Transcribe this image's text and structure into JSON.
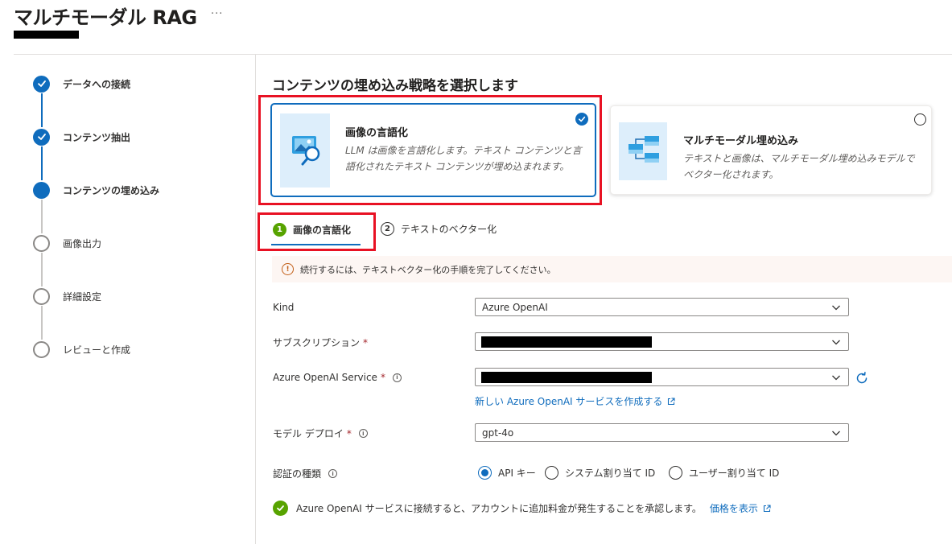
{
  "page": {
    "title": "マルチモーダル RAG",
    "more_label": "···"
  },
  "steps": [
    {
      "label": "データへの接続",
      "state": "done"
    },
    {
      "label": "コンテンツ抽出",
      "state": "done"
    },
    {
      "label": "コンテンツの埋め込み",
      "state": "current"
    },
    {
      "label": "画像出力",
      "state": "todo"
    },
    {
      "label": "詳細設定",
      "state": "todo"
    },
    {
      "label": "レビューと作成",
      "state": "todo"
    }
  ],
  "main": {
    "heading": "コンテンツの埋め込み戦略を選択します",
    "cards": [
      {
        "title": "画像の言語化",
        "description": "LLM は画像を言語化します。テキスト コンテンツと言語化されたテキスト コンテンツが埋め込まれます。",
        "selected": true
      },
      {
        "title": "マルチモーダル埋め込み",
        "description": "テキストと画像は、マルチモーダル埋め込みモデルでベクター化されます。",
        "selected": false
      }
    ],
    "tabs": [
      {
        "number": "1",
        "label": "画像の言語化",
        "active": true
      },
      {
        "number": "2",
        "label": "テキストのベクター化",
        "active": false
      }
    ],
    "warning": "続行するには、テキストベクター化の手順を完了してください。"
  },
  "form": {
    "kind_label": "Kind",
    "kind_value": "Azure OpenAI",
    "subscription_label": "サブスクリプション",
    "service_label": "Azure OpenAI Service",
    "create_link": "新しい Azure OpenAI サービスを作成する",
    "deploy_label": "モデル デプロイ",
    "deploy_value": "gpt-4o",
    "auth_label": "認証の種類",
    "required_mark": "*",
    "auth_options": [
      {
        "label": "API キー",
        "selected": true
      },
      {
        "label": "システム割り当て ID",
        "selected": false
      },
      {
        "label": "ユーザー割り当て ID",
        "selected": false
      }
    ]
  },
  "acknowledgement": {
    "text": "Azure OpenAI サービスに接続すると、アカウントに追加料金が発生することを承認します。",
    "link": "価格を表示"
  },
  "colors": {
    "accent": "#0f6cbd",
    "success": "#57a300",
    "highlight": "#e81123"
  }
}
